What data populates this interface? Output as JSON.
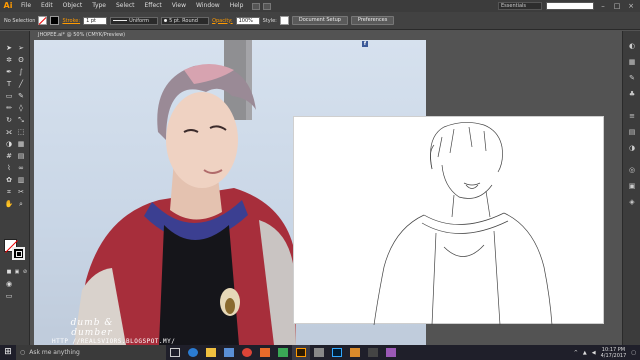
{
  "app": {
    "logo": "Ai",
    "document_tab": "JHOPEE.ai* @ 50% (CMYK/Preview)"
  },
  "menu": {
    "items": [
      "File",
      "Edit",
      "Object",
      "Type",
      "Select",
      "Effect",
      "View",
      "Window",
      "Help"
    ]
  },
  "menubar_right": {
    "workspace": "Essentials",
    "minimize": "–",
    "maximize": "□",
    "close": "×"
  },
  "control_bar": {
    "selection": "No Selection",
    "stroke_label": "Stroke:",
    "stroke_weight": "1 pt",
    "profile": "Uniform",
    "brush": "5 pt. Round",
    "opacity_label": "Opacity:",
    "opacity_value": "100%",
    "style_label": "Style:",
    "document_setup": "Document Setup",
    "preferences": "Preferences"
  },
  "photo": {
    "logo_text": "f"
  },
  "watermark": {
    "title": "dumb & dumber",
    "url": "HTTP //REALSVIORS.BLOGSPOT.MY/"
  },
  "taskbar": {
    "search_placeholder": "Ask me anything",
    "time": "10:17 PM",
    "date": "4/17/2017"
  },
  "colors": {
    "accent": "#ff9a00",
    "ui_dark": "#3c3c3c",
    "canvas": "#535353"
  }
}
